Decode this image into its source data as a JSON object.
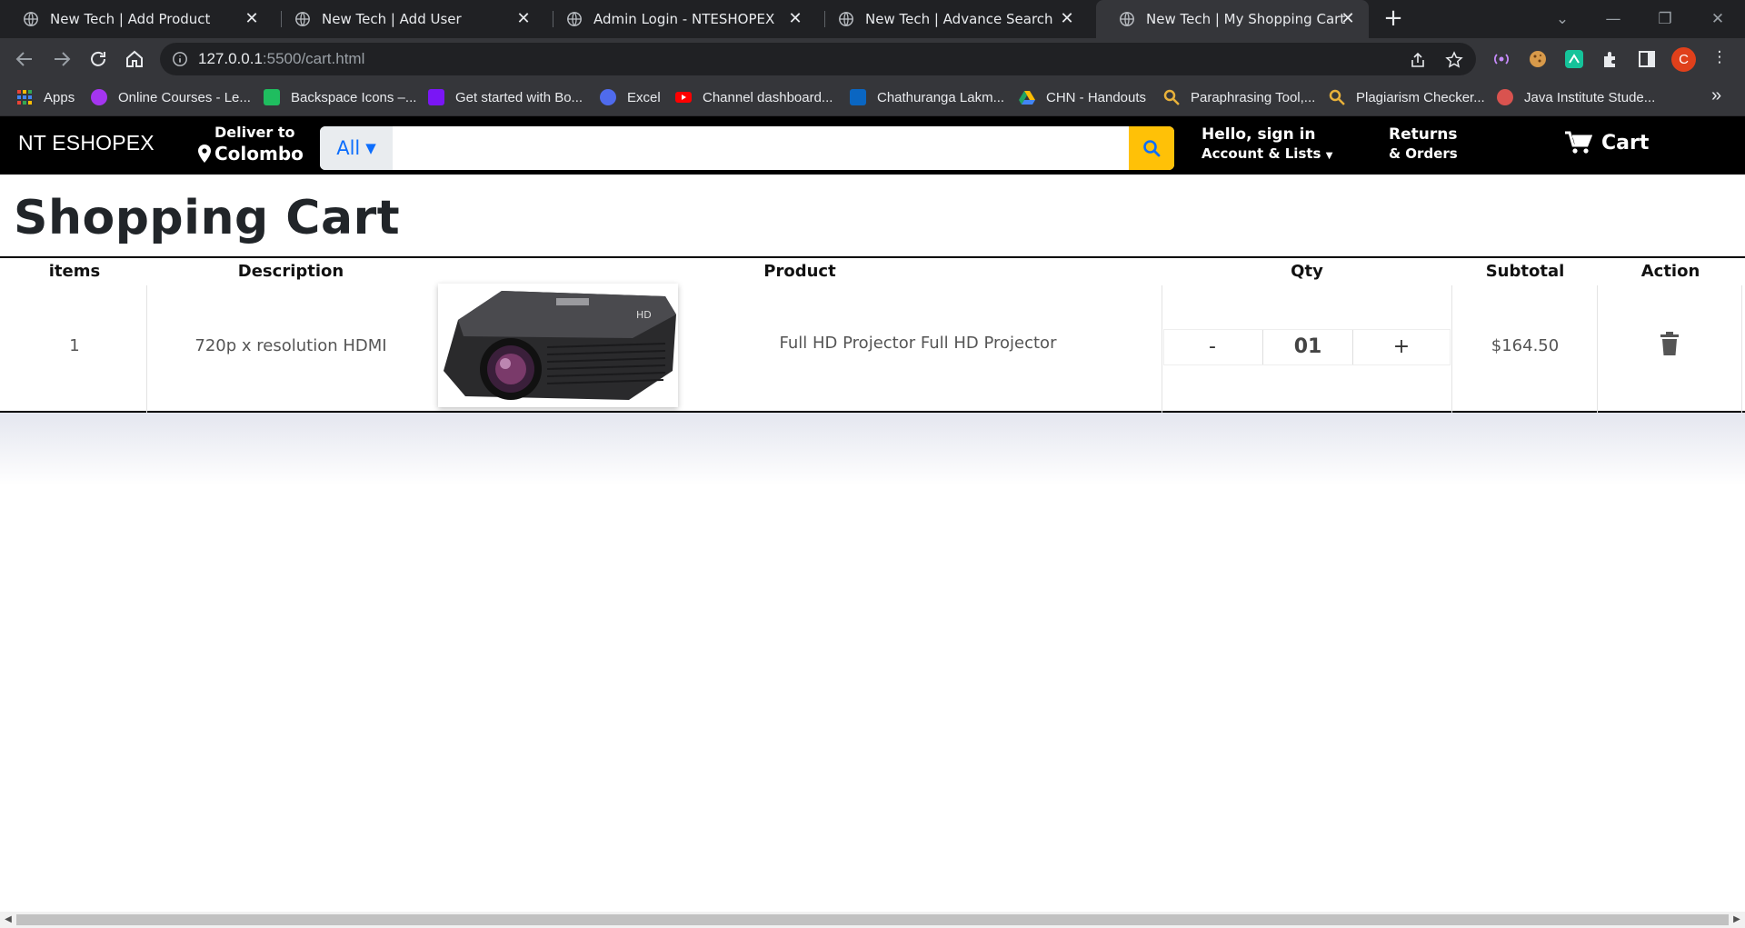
{
  "browser": {
    "tabs": [
      {
        "title": "New Tech | Add Product",
        "active": false
      },
      {
        "title": "New Tech | Add User",
        "active": false
      },
      {
        "title": "Admin Login - NTESHOPEX",
        "active": false
      },
      {
        "title": "New Tech | Advance Search",
        "active": false
      },
      {
        "title": "New Tech | My Shopping Cart",
        "active": true
      }
    ],
    "url_host": "127.0.0.1",
    "url_rest": ":5500/cart.html",
    "avatar_letter": "C",
    "bookmarks": [
      {
        "label": "Apps",
        "icon": "apps-grid-icon",
        "color": "#4285f4"
      },
      {
        "label": "Online Courses - Le...",
        "icon": "udemy-icon",
        "color": "#a435f0"
      },
      {
        "label": "Backspace Icons –...",
        "icon": "backspace-icons-icon",
        "color": "#1fbd5f"
      },
      {
        "label": "Get started with Bo...",
        "icon": "bootstrap-icon",
        "color": "#7a16f5"
      },
      {
        "label": "Excel",
        "icon": "excel-icon",
        "color": "#4f6bed"
      },
      {
        "label": "Channel dashboard...",
        "icon": "youtube-icon",
        "color": "#ff0000"
      },
      {
        "label": "Chathuranga Lakm...",
        "icon": "linkedin-icon",
        "color": "#0a66c2"
      },
      {
        "label": "CHN - Handouts",
        "icon": "google-drive-icon",
        "color": "#fbbc04"
      },
      {
        "label": "Paraphrasing Tool,...",
        "icon": "magnifier-icon",
        "color": "#e8b13a"
      },
      {
        "label": "Plagiarism Checker...",
        "icon": "magnifier-icon",
        "color": "#e8b13a"
      },
      {
        "label": "Java Institute Stude...",
        "icon": "java-icon",
        "color": "#d9534f"
      }
    ]
  },
  "header": {
    "logo": "NT ESHOPEX",
    "deliver_label": "Deliver to",
    "deliver_location": "Colombo",
    "search_category": "All",
    "search_placeholder": "",
    "account_line1": "Hello, sign in",
    "account_line2": "Account & Lists",
    "returns_line1": "Returns",
    "returns_line2": "& Orders",
    "cart_label": "Cart"
  },
  "page": {
    "title": "Shopping Cart"
  },
  "cart": {
    "columns": [
      "items",
      "Description",
      "Product",
      "Qty",
      "Subtotal",
      "Action"
    ],
    "rows": [
      {
        "item": "1",
        "description": "720p x resolution HDMI",
        "product_name": "Full HD Projector Full HD Projector",
        "qty_minus": "-",
        "qty": "01",
        "qty_plus": "+",
        "subtotal": "$164.50"
      }
    ]
  }
}
